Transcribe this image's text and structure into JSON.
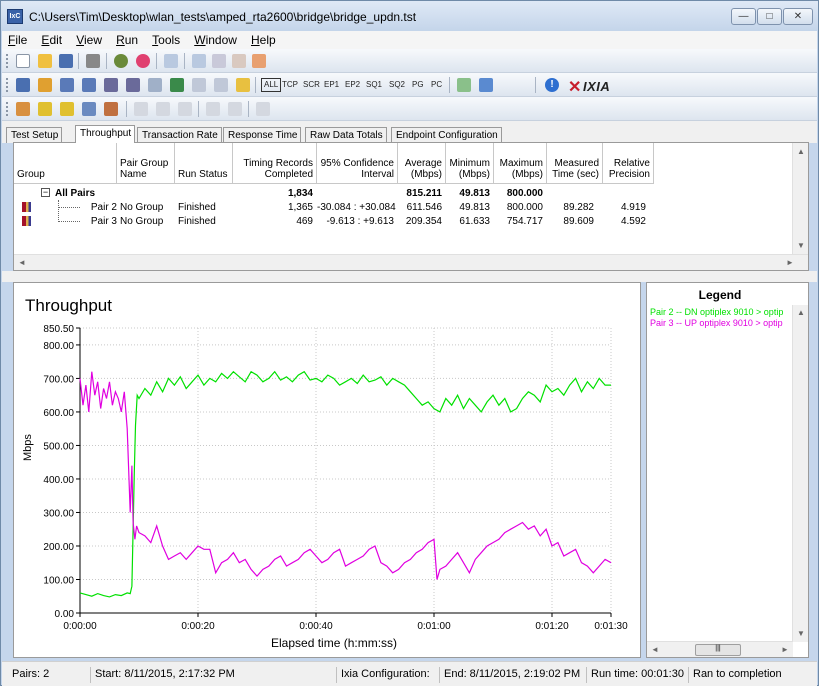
{
  "window": {
    "title": "C:\\Users\\Tim\\Desktop\\wlan_tests\\amped_rta2600\\bridge\\bridge_updn.tst",
    "icon_label": "IxC",
    "minimize_glyph": "—",
    "maximize_glyph": "□",
    "close_glyph": "✕"
  },
  "menu": [
    {
      "underline": "F",
      "rest": "ile"
    },
    {
      "underline": "E",
      "rest": "dit"
    },
    {
      "underline": "V",
      "rest": "iew"
    },
    {
      "underline": "R",
      "rest": "un"
    },
    {
      "underline": "T",
      "rest": "ools"
    },
    {
      "underline": "W",
      "rest": "indow"
    },
    {
      "underline": "H",
      "rest": "elp"
    }
  ],
  "toolbar": {
    "protocols": [
      "ALL",
      "TCP",
      "SCR",
      "EP1",
      "EP2",
      "SQ1",
      "SQ2",
      "PG",
      "PC"
    ],
    "info_glyph": "!",
    "brand_x": "✕",
    "brand": "IXIA"
  },
  "tabs": [
    "Test Setup",
    "Throughput",
    "Transaction Rate",
    "Response Time",
    "Raw Data Totals",
    "Endpoint Configuration"
  ],
  "active_tab": "Throughput",
  "results_table": {
    "columns": [
      "Group",
      "Pair Group\nName",
      "Run Status",
      "Timing Records\nCompleted",
      "95% Confidence\nInterval",
      "Average\n(Mbps)",
      "Minimum\n(Mbps)",
      "Maximum\n(Mbps)",
      "Measured\nTime (sec)",
      "Relative\nPrecision"
    ],
    "summary": {
      "expander": "−",
      "label": "All Pairs",
      "records": "1,834",
      "average": "815.211",
      "minimum": "49.813",
      "maximum": "800.000"
    },
    "rows": [
      {
        "pair": "Pair 2",
        "group_name": "No Group",
        "status": "Finished",
        "records": "1,365",
        "ci": "-30.084 : +30.084",
        "average": "611.546",
        "minimum": "49.813",
        "maximum": "800.000",
        "time": "89.282",
        "precision": "4.919"
      },
      {
        "pair": "Pair 3",
        "group_name": "No Group",
        "status": "Finished",
        "records": "469",
        "ci": "-9.613 : +9.613",
        "average": "209.354",
        "minimum": "61.633",
        "maximum": "754.717",
        "time": "89.609",
        "precision": "4.592"
      }
    ],
    "scroll_up": "▲",
    "scroll_down": "▼",
    "scroll_left": "◄",
    "scroll_right": "►"
  },
  "chart_data": {
    "type": "line",
    "title": "Throughput",
    "xlabel": "Elapsed time (h:mm:ss)",
    "ylabel": "Mbps",
    "ylim": [
      0,
      850.5
    ],
    "xlim": [
      0,
      90
    ],
    "y_ticks": [
      "0.00",
      "100.00",
      "200.00",
      "300.00",
      "400.00",
      "500.00",
      "600.00",
      "700.00",
      "800.00",
      "850.50"
    ],
    "y_tick_values": [
      0,
      100,
      200,
      300,
      400,
      500,
      600,
      700,
      800,
      850.5
    ],
    "x_ticks": [
      "0:00:00",
      "0:00:20",
      "0:00:40",
      "0:01:00",
      "0:01:20",
      "0:01:30"
    ],
    "x_tick_values": [
      0,
      20,
      40,
      60,
      80,
      90
    ],
    "grid": true,
    "series": [
      {
        "name": "Pair 2 -- DN optiplex 9010 > optip",
        "color": "#00e000",
        "points": [
          [
            0,
            60
          ],
          [
            1,
            55
          ],
          [
            2,
            50
          ],
          [
            3,
            58
          ],
          [
            4,
            52
          ],
          [
            5,
            48
          ],
          [
            6,
            55
          ],
          [
            7,
            52
          ],
          [
            8,
            60
          ],
          [
            8.5,
            58
          ],
          [
            8.8,
            80
          ],
          [
            9,
            250
          ],
          [
            9.2,
            420
          ],
          [
            9.4,
            560
          ],
          [
            9.7,
            650
          ],
          [
            10,
            640
          ],
          [
            11,
            670
          ],
          [
            12,
            650
          ],
          [
            13,
            690
          ],
          [
            14,
            660
          ],
          [
            15,
            700
          ],
          [
            16,
            680
          ],
          [
            17,
            705
          ],
          [
            18,
            670
          ],
          [
            19,
            690
          ],
          [
            20,
            710
          ],
          [
            21,
            680
          ],
          [
            22,
            700
          ],
          [
            23,
            690
          ],
          [
            24,
            715
          ],
          [
            25,
            700
          ],
          [
            26,
            720
          ],
          [
            27,
            705
          ],
          [
            28,
            690
          ],
          [
            29,
            720
          ],
          [
            30,
            710
          ],
          [
            31,
            690
          ],
          [
            32,
            700
          ],
          [
            33,
            720
          ],
          [
            34,
            695
          ],
          [
            35,
            705
          ],
          [
            36,
            690
          ],
          [
            37,
            710
          ],
          [
            38,
            720
          ],
          [
            39,
            695
          ],
          [
            40,
            700
          ],
          [
            41,
            690
          ],
          [
            42,
            710
          ],
          [
            43,
            700
          ],
          [
            44,
            680
          ],
          [
            45,
            690
          ],
          [
            46,
            700
          ],
          [
            47,
            685
          ],
          [
            48,
            710
          ],
          [
            49,
            690
          ],
          [
            50,
            695
          ],
          [
            51,
            705
          ],
          [
            52,
            680
          ],
          [
            53,
            700
          ],
          [
            54,
            690
          ],
          [
            55,
            680
          ],
          [
            56,
            660
          ],
          [
            57,
            640
          ],
          [
            58,
            620
          ],
          [
            59,
            630
          ],
          [
            60,
            610
          ],
          [
            61,
            600
          ],
          [
            62,
            640
          ],
          [
            63,
            620
          ],
          [
            64,
            650
          ],
          [
            65,
            610
          ],
          [
            66,
            640
          ],
          [
            67,
            620
          ],
          [
            68,
            600
          ],
          [
            69,
            630
          ],
          [
            70,
            650
          ],
          [
            71,
            620
          ],
          [
            72,
            640
          ],
          [
            73,
            600
          ],
          [
            74,
            610
          ],
          [
            75,
            640
          ],
          [
            76,
            660
          ],
          [
            77,
            650
          ],
          [
            78,
            630
          ],
          [
            79,
            680
          ],
          [
            80,
            660
          ],
          [
            81,
            670
          ],
          [
            82,
            650
          ],
          [
            83,
            680
          ],
          [
            84,
            700
          ],
          [
            85,
            660
          ],
          [
            86,
            690
          ],
          [
            87,
            670
          ],
          [
            88,
            700
          ],
          [
            89,
            680
          ],
          [
            90,
            680
          ]
        ]
      },
      {
        "name": "Pair 3 -- UP optiplex 9010 > optip",
        "color": "#e000e0",
        "points": [
          [
            0,
            700
          ],
          [
            0.5,
            620
          ],
          [
            1,
            680
          ],
          [
            1.5,
            600
          ],
          [
            2,
            720
          ],
          [
            2.5,
            650
          ],
          [
            3,
            690
          ],
          [
            3.5,
            610
          ],
          [
            4,
            670
          ],
          [
            4.5,
            640
          ],
          [
            5,
            690
          ],
          [
            5.5,
            620
          ],
          [
            6,
            660
          ],
          [
            6.5,
            640
          ],
          [
            7,
            600
          ],
          [
            7.5,
            660
          ],
          [
            8,
            550
          ],
          [
            8.5,
            300
          ],
          [
            8.8,
            440
          ],
          [
            9,
            270
          ],
          [
            9.3,
            220
          ],
          [
            9.6,
            260
          ],
          [
            10,
            240
          ],
          [
            11,
            230
          ],
          [
            12,
            210
          ],
          [
            13,
            260
          ],
          [
            14,
            200
          ],
          [
            15,
            160
          ],
          [
            16,
            170
          ],
          [
            17,
            180
          ],
          [
            18,
            160
          ],
          [
            19,
            180
          ],
          [
            20,
            200
          ],
          [
            21,
            190
          ],
          [
            22,
            190
          ],
          [
            23,
            120
          ],
          [
            24,
            150
          ],
          [
            25,
            160
          ],
          [
            26,
            180
          ],
          [
            27,
            150
          ],
          [
            28,
            160
          ],
          [
            29,
            130
          ],
          [
            30,
            110
          ],
          [
            31,
            130
          ],
          [
            32,
            140
          ],
          [
            33,
            160
          ],
          [
            34,
            170
          ],
          [
            35,
            140
          ],
          [
            36,
            150
          ],
          [
            37,
            160
          ],
          [
            38,
            180
          ],
          [
            39,
            190
          ],
          [
            40,
            170
          ],
          [
            41,
            150
          ],
          [
            42,
            160
          ],
          [
            43,
            180
          ],
          [
            44,
            190
          ],
          [
            45,
            140
          ],
          [
            46,
            150
          ],
          [
            47,
            160
          ],
          [
            48,
            170
          ],
          [
            49,
            190
          ],
          [
            50,
            200
          ],
          [
            51,
            150
          ],
          [
            52,
            140
          ],
          [
            53,
            120
          ],
          [
            54,
            130
          ],
          [
            55,
            150
          ],
          [
            56,
            160
          ],
          [
            57,
            180
          ],
          [
            58,
            190
          ],
          [
            59,
            210
          ],
          [
            60,
            220
          ],
          [
            60.5,
            100
          ],
          [
            61,
            130
          ],
          [
            62,
            140
          ],
          [
            63,
            160
          ],
          [
            64,
            180
          ],
          [
            65,
            150
          ],
          [
            66,
            120
          ],
          [
            67,
            160
          ],
          [
            68,
            180
          ],
          [
            69,
            200
          ],
          [
            70,
            210
          ],
          [
            71,
            220
          ],
          [
            72,
            240
          ],
          [
            73,
            250
          ],
          [
            74,
            260
          ],
          [
            75,
            270
          ],
          [
            76,
            250
          ],
          [
            77,
            260
          ],
          [
            78,
            230
          ],
          [
            79,
            250
          ],
          [
            80,
            200
          ],
          [
            81,
            210
          ],
          [
            82,
            170
          ],
          [
            83,
            180
          ],
          [
            84,
            190
          ],
          [
            85,
            150
          ],
          [
            86,
            140
          ],
          [
            87,
            120
          ],
          [
            88,
            140
          ],
          [
            89,
            160
          ],
          [
            90,
            150
          ]
        ]
      }
    ]
  },
  "legend": {
    "title": "Legend",
    "items": [
      {
        "label": "Pair 2 -- DN optiplex 9010 > optip",
        "color": "#00e000"
      },
      {
        "label": "Pair 3 -- UP optiplex 9010 > optip",
        "color": "#e000e0"
      }
    ],
    "thumb_glyph": "|||"
  },
  "status": {
    "pairs": "Pairs: 2",
    "start": "Start: 8/11/2015, 2:17:32 PM",
    "ixia_config": "Ixia Configuration:",
    "end": "End: 8/11/2015, 2:19:02 PM",
    "run_time": "Run time: 00:01:30",
    "completion": "Ran to completion"
  }
}
